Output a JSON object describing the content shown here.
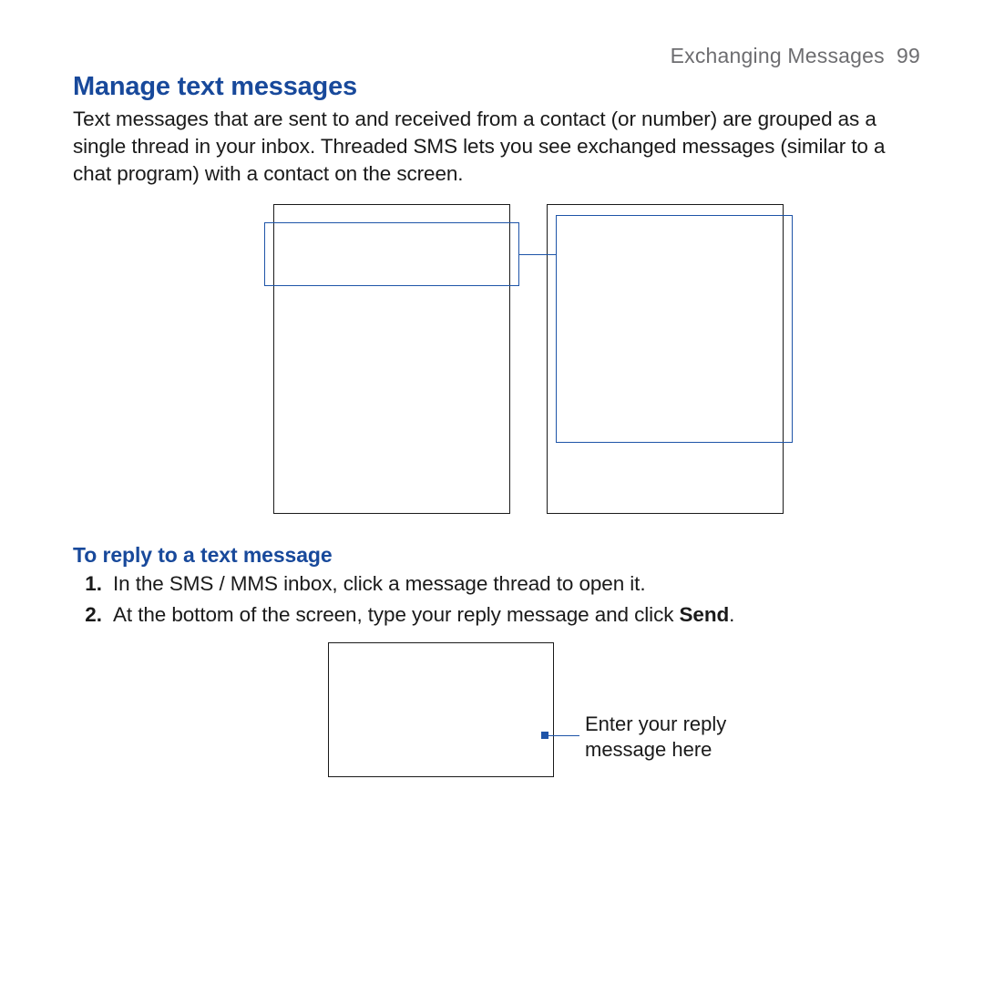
{
  "header": {
    "chapter": "Exchanging Messages",
    "page_number": "99"
  },
  "section": {
    "title": "Manage text messages",
    "intro": "Text messages that are sent to and received from a contact (or number) are grouped as a single thread in your inbox. Threaded SMS lets you see exchanged messages (similar to a chat program) with a contact on the screen."
  },
  "reply": {
    "title": "To reply to a text message",
    "step1": "In the SMS / MMS inbox, click a message thread to open it.",
    "step2_pre": "At the bottom of the screen, type your reply message and click ",
    "step2_bold": "Send",
    "step2_post": ".",
    "callout": "Enter your reply message here"
  }
}
